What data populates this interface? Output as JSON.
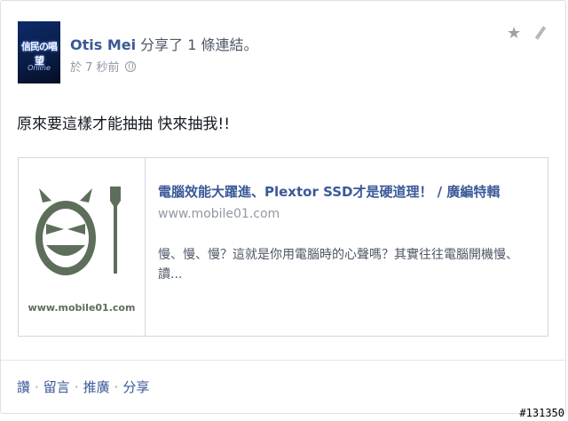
{
  "post": {
    "author": "Otis Mei",
    "action_text": " 分享了 1 條連結。",
    "timestamp": "於 7 秒前",
    "avatar_text": "信民の唱望",
    "avatar_subtext": "Online",
    "message": "原來要這樣才能抽抽 快來抽我!!"
  },
  "link_preview": {
    "thumbnail_caption": "www.mobile01.com",
    "title": "電腦效能大躍進、Plextor SSD才是硬道理！ / 廣編特輯",
    "domain": "www.mobile01.com",
    "description": "慢、慢、慢？這就是你用電腦時的心聲嗎？其實往往電腦開機慢、讀..."
  },
  "actions": {
    "like": "讚",
    "comment": "留言",
    "promote": "推廣",
    "share": "分享",
    "separator": "·"
  },
  "icons": {
    "star": "star-icon",
    "edit": "pencil-icon",
    "privacy": "globe-icon"
  },
  "watermark": "#131350",
  "colors": {
    "link_blue": "#3b5998",
    "meta_gray": "#9197a3",
    "logo_green": "#5d6e5a"
  }
}
